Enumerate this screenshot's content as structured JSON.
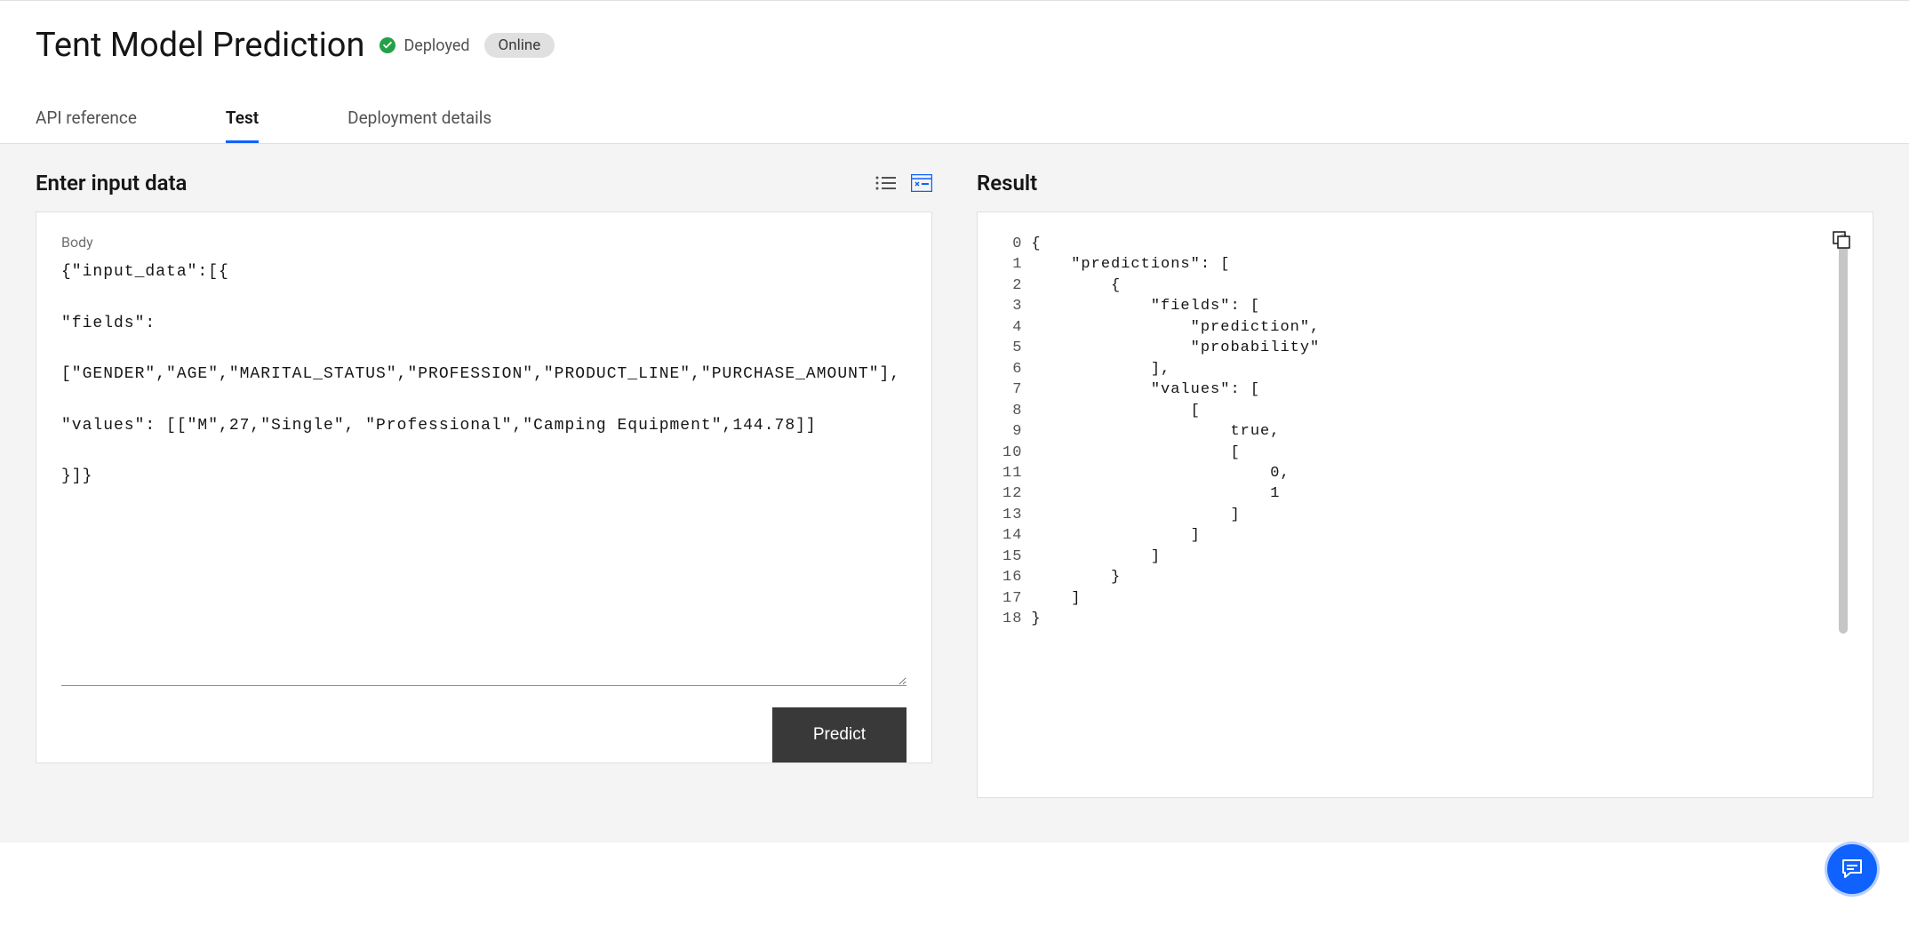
{
  "header": {
    "title": "Tent Model Prediction",
    "statusText": "Deployed",
    "statusBadge": "Online"
  },
  "tabs": {
    "items": [
      {
        "label": "API reference",
        "active": false
      },
      {
        "label": "Test",
        "active": true
      },
      {
        "label": "Deployment details",
        "active": false
      }
    ]
  },
  "inputPanel": {
    "title": "Enter input data",
    "bodyLabel": "Body",
    "bodyValue": "{\"input_data\":[{\n\n\"fields\":\n\n[\"GENDER\",\"AGE\",\"MARITAL_STATUS\",\"PROFESSION\",\"PRODUCT_LINE\",\"PURCHASE_AMOUNT\"],\n\n\"values\": [[\"M\",27,\"Single\", \"Professional\",\"Camping Equipment\",144.78]]\n\n}]}",
    "predictLabel": "Predict"
  },
  "resultPanel": {
    "title": "Result",
    "lines": [
      "{",
      "    \"predictions\": [",
      "        {",
      "            \"fields\": [",
      "                \"prediction\",",
      "                \"probability\"",
      "            ],",
      "            \"values\": [",
      "                [",
      "                    true,",
      "                    [",
      "                        0,",
      "                        1",
      "                    ]",
      "                ]",
      "            ]",
      "        }",
      "    ]",
      "}"
    ]
  }
}
